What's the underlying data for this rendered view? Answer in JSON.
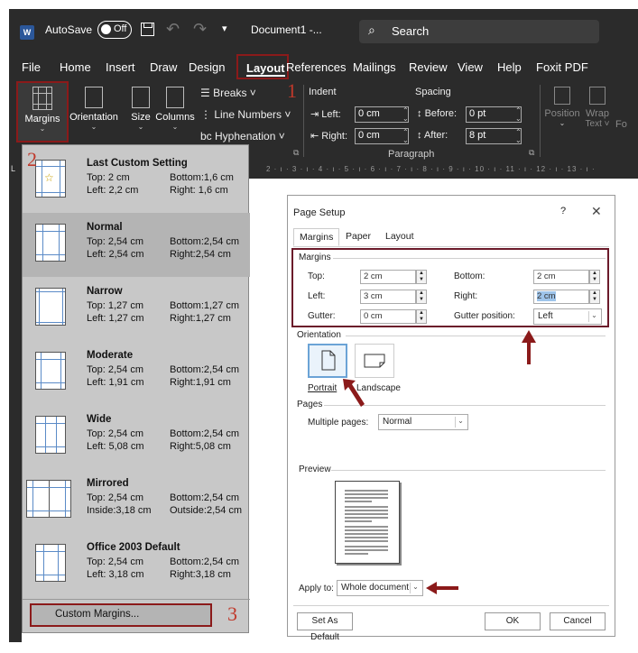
{
  "titlebar": {
    "logo": "W",
    "autosave_label": "AutoSave",
    "autosave_state": "Off",
    "qa_dropdown": "▾",
    "document_name": "Document1 -...",
    "search_label": "Search",
    "icons": [
      "word-logo-icon",
      "save-icon",
      "undo-icon",
      "redo-icon",
      "search-icon"
    ]
  },
  "menu": {
    "items": [
      "File",
      "Home",
      "Insert",
      "Draw",
      "Design",
      "Layout",
      "References",
      "Mailings",
      "Review",
      "View",
      "Help",
      "Foxit PDF"
    ],
    "active": "Layout"
  },
  "ribbon": {
    "margins": "Margins",
    "orientation": "Orientation",
    "size": "Size",
    "columns": "Columns",
    "breaks": "Breaks",
    "line_numbers": "Line Numbers",
    "hyphenation": "Hyphenation",
    "indent_label": "Indent",
    "spacing_label": "Spacing",
    "left_label": "Left:",
    "right_label": "Right:",
    "left_value": "0 cm",
    "right_value": "0 cm",
    "before_label": "Before:",
    "after_label": "After:",
    "before_value": "0 pt",
    "after_value": "8 pt",
    "paragraph_group": "Paragraph",
    "position": "Position",
    "wrap_text_1": "Wrap",
    "wrap_text_2": "Text",
    "forward_partial": "Fo"
  },
  "ruler": {
    "ticks": "2 · ı · 3 · ı · 4 · ı · 5 · ı · 6 · ı · 7 · ı · 8 · ı · 9 · ı · 10 · ı · 11 · ı · 12 · ı · 13 · ı ·"
  },
  "step_markers": {
    "one": "1",
    "two": "2",
    "three": "3"
  },
  "margins_dropdown": {
    "items": [
      {
        "title": "Last Custom Setting",
        "l1": "Top:    2 cm",
        "r1": "Bottom:1,6 cm",
        "l2": "Left:   2,2 cm",
        "r2": "Right: 1,6 cm"
      },
      {
        "title": "Normal",
        "l1": "Top:  2,54 cm",
        "r1": "Bottom:2,54 cm",
        "l2": "Left:  2,54 cm",
        "r2": "Right:2,54 cm"
      },
      {
        "title": "Narrow",
        "l1": "Top:  1,27 cm",
        "r1": "Bottom:1,27 cm",
        "l2": "Left:  1,27 cm",
        "r2": "Right:1,27 cm"
      },
      {
        "title": "Moderate",
        "l1": "Top:  2,54 cm",
        "r1": "Bottom:2,54 cm",
        "l2": "Left:  1,91 cm",
        "r2": "Right:1,91 cm"
      },
      {
        "title": "Wide",
        "l1": "Top:  2,54 cm",
        "r1": "Bottom:2,54 cm",
        "l2": "Left:  5,08 cm",
        "r2": "Right:5,08 cm"
      },
      {
        "title": "Mirrored",
        "l1": "Top:  2,54 cm",
        "r1": "Bottom:2,54 cm",
        "l2": "Inside:3,18 cm",
        "r2": "Outside:2,54 cm"
      },
      {
        "title": "Office 2003 Default",
        "l1": "Top:  2,54 cm",
        "r1": "Bottom:2,54 cm",
        "l2": "Left:  3,18 cm",
        "r2": "Right:3,18 cm"
      }
    ],
    "selected": "Normal",
    "custom_margins": "Custom Margins..."
  },
  "page_setup": {
    "title": "Page Setup",
    "help": "?",
    "close": "✕",
    "tabs": [
      "Margins",
      "Paper",
      "Layout"
    ],
    "active_tab": "Margins",
    "margins_section": "Margins",
    "top_label": "Top:",
    "top_value": "2 cm",
    "bottom_label": "Bottom:",
    "bottom_value": "2 cm",
    "left_label": "Left:",
    "left_value": "3 cm",
    "right_label": "Right:",
    "right_value": "2 cm",
    "gutter_label": "Gutter:",
    "gutter_value": "0 cm",
    "gutter_position_label": "Gutter position:",
    "gutter_position_value": "Left",
    "orientation_section": "Orientation",
    "portrait": "Portrait",
    "landscape": "Landscape",
    "pages_section": "Pages",
    "multiple_pages_label": "Multiple pages:",
    "multiple_pages_value": "Normal",
    "preview_section": "Preview",
    "apply_to_label": "Apply to:",
    "apply_to_value": "Whole document",
    "set_as_default": "Set As Default",
    "ok": "OK",
    "cancel": "Cancel"
  },
  "colors": {
    "dark_ui": "#2b2b2b",
    "annotation_red": "#8b1a1a",
    "dropdown_bg": "#c8c8c8",
    "selection_blue": "#6ba3d6"
  }
}
